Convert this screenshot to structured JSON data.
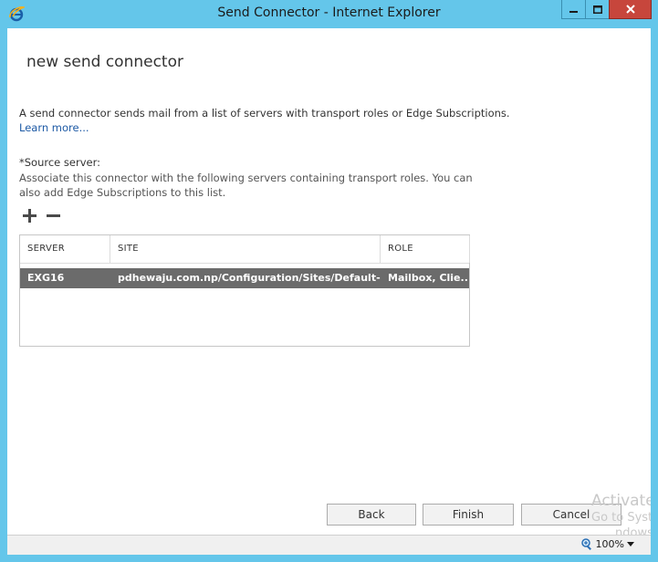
{
  "window": {
    "title": "Send Connector - Internet Explorer"
  },
  "page": {
    "heading": "new send connector",
    "description": "A send connector sends mail from a list of servers with transport roles or Edge Subscriptions.",
    "learn_more": "Learn more...",
    "source_server_label": "*Source server:",
    "source_server_desc": "Associate this connector with the following servers containing transport roles. You can also add Edge Subscriptions to this list."
  },
  "table": {
    "columns": [
      "SERVER",
      "SITE",
      "ROLE"
    ],
    "rows": [
      {
        "server": "EXG16",
        "site": "pdhewaju.com.np/Configuration/Sites/Default-Fi...",
        "role": "Mailbox, Clie..."
      }
    ]
  },
  "buttons": {
    "back": "Back",
    "finish": "Finish",
    "cancel": "Cancel"
  },
  "watermark": {
    "line1": "Activate",
    "line2": "Go to Syst",
    "line3": "ndows."
  },
  "statusbar": {
    "zoom": "100%"
  },
  "colors": {
    "frame": "#64c6ea",
    "close_button": "#c7463c",
    "selected_row": "#6b6b6b",
    "link": "#1e5aa5"
  },
  "icons": {
    "app": "internet-explorer-icon",
    "add": "plus-icon",
    "remove": "minus-icon",
    "zoom": "zoom-icon",
    "zoom_dropdown": "chevron-down-icon"
  }
}
